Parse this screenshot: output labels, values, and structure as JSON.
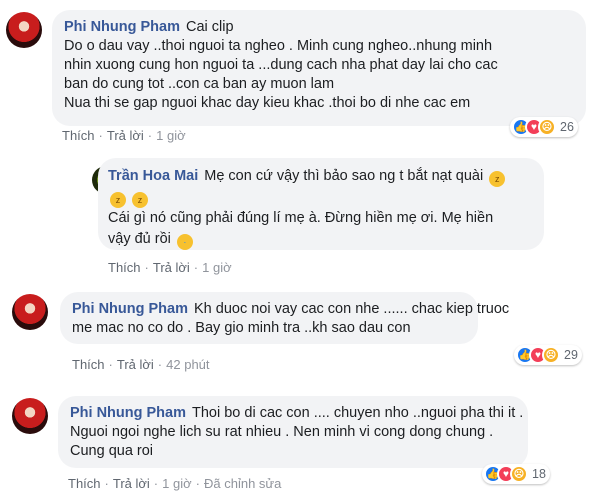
{
  "comments": [
    {
      "author": "Phi Nhung Pham",
      "lines": [
        "Cai clip",
        "Do o dau vay ..thoi nguoi ta ngheo . Minh cung ngheo..nhung minh",
        "nhin xuong cung hon nguoi ta ...dung cach nha phat day lai cho cac",
        "ban do cung tot ..con ca ban ay muon lam",
        "Nua thi se gap nguoi khac day kieu khac .thoi bo di nhe cac em"
      ],
      "like": "Thích",
      "reply": "Trả lời",
      "time": "1 giờ",
      "reaction_count": "26",
      "reactions": [
        "like-icon",
        "love-icon",
        "sad-icon"
      ]
    },
    {
      "author": "Trần Hoa Mai",
      "lines": [
        "Mẹ con cứ vậy thì bảo sao ng t bắt nạt quài",
        "Cái gì nó cũng phải đúng lí mẹ à. Đừng hiền mẹ ơi. Mẹ hiền",
        "vậy đủ rồi"
      ],
      "like": "Thích",
      "reply": "Trả lời",
      "time": "1 giờ"
    },
    {
      "author": "Phi Nhung Pham",
      "lines": [
        "Kh duoc noi vay cac con nhe ...... chac kiep truoc",
        "me mac no co do . Bay gio minh tra ..kh sao dau con"
      ],
      "like": "Thích",
      "reply": "Trả lời",
      "time": "42 phút",
      "reaction_count": "29",
      "reactions": [
        "like-icon",
        "love-icon",
        "sad-icon"
      ]
    },
    {
      "author": "Phi Nhung Pham",
      "lines": [
        "Thoi bo di cac con .... chuyen nho ..nguoi pha thi it .",
        "Nguoi ngoi nghe lich su rat nhieu . Nen minh vi cong dong chung .",
        "Cung qua roi"
      ],
      "like": "Thích",
      "reply": "Trả lời",
      "time": "1 giờ",
      "edited": "Đã chỉnh sửa",
      "reaction_count": "18",
      "reactions": [
        "like-icon",
        "love-icon",
        "sad-icon"
      ]
    }
  ]
}
